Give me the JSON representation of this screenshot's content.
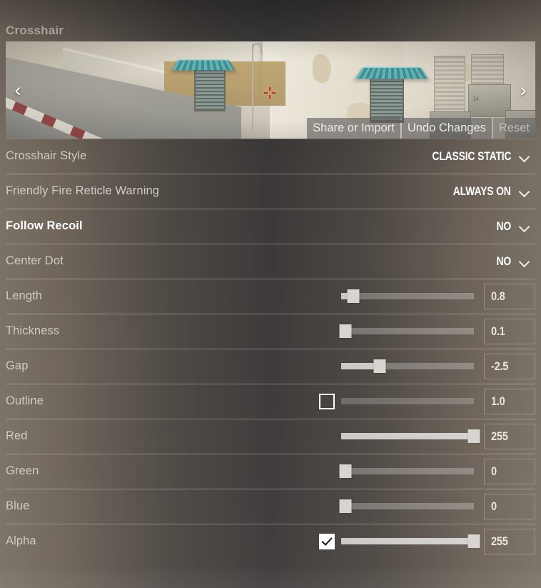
{
  "header": {
    "title": "Crosshair"
  },
  "preview": {
    "prev_arrow": "‹",
    "next_arrow": "›",
    "reticle_color": "#e02020",
    "actions": [
      {
        "label": "Share or Import",
        "dimmed": false
      },
      {
        "label": "Undo Changes",
        "dimmed": false
      },
      {
        "label": "Reset",
        "dimmed": true
      }
    ]
  },
  "settings": {
    "rows": [
      {
        "label": "Crosshair Style",
        "type": "dropdown",
        "value": "CLASSIC STATIC",
        "highlighted": false
      },
      {
        "label": "Friendly Fire Reticle Warning",
        "type": "dropdown",
        "value": "ALWAYS ON",
        "highlighted": false
      },
      {
        "label": "Follow Recoil",
        "type": "dropdown",
        "value": "NO",
        "highlighted": true
      },
      {
        "label": "Center Dot",
        "type": "dropdown",
        "value": "NO",
        "highlighted": false
      },
      {
        "label": "Length",
        "type": "slider",
        "value": "0.8",
        "percent": 9,
        "checkbox": null,
        "disabled": false,
        "highlighted": false
      },
      {
        "label": "Thickness",
        "type": "slider",
        "value": "0.1",
        "percent": 3,
        "checkbox": null,
        "disabled": false,
        "highlighted": false
      },
      {
        "label": "Gap",
        "type": "slider",
        "value": "-2.5",
        "percent": 29,
        "checkbox": null,
        "disabled": false,
        "highlighted": false
      },
      {
        "label": "Outline",
        "type": "slider",
        "value": "1.0",
        "percent": 0,
        "checkbox": "off",
        "disabled": true,
        "highlighted": false
      },
      {
        "label": "Red",
        "type": "slider",
        "value": "255",
        "percent": 100,
        "checkbox": null,
        "disabled": false,
        "highlighted": false
      },
      {
        "label": "Green",
        "type": "slider",
        "value": "0",
        "percent": 3,
        "checkbox": null,
        "disabled": false,
        "highlighted": false
      },
      {
        "label": "Blue",
        "type": "slider",
        "value": "0",
        "percent": 3,
        "checkbox": null,
        "disabled": false,
        "highlighted": false
      },
      {
        "label": "Alpha",
        "type": "slider",
        "value": "255",
        "percent": 100,
        "checkbox": "on",
        "disabled": false,
        "highlighted": false
      }
    ]
  }
}
